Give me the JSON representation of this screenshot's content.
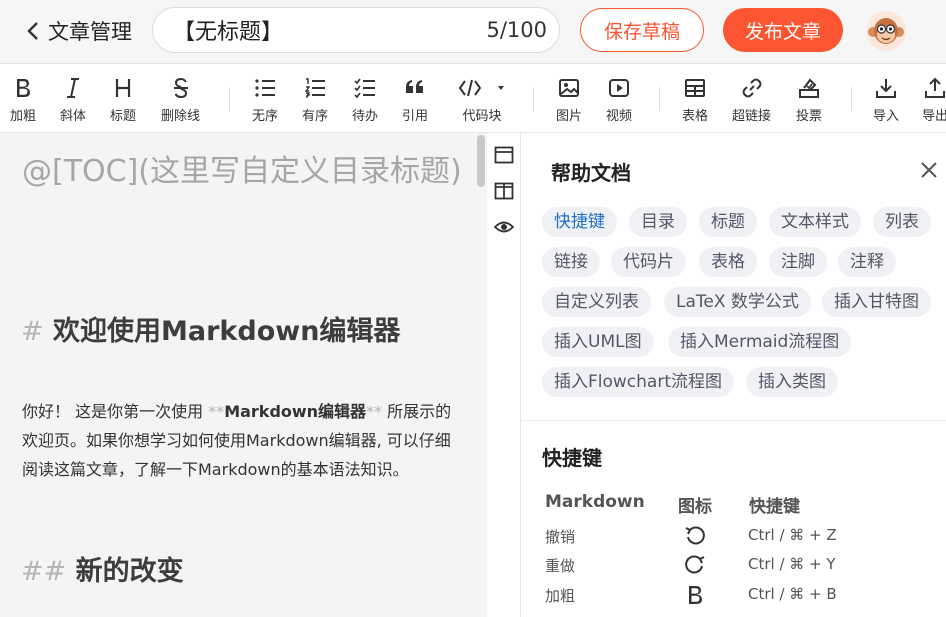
{
  "header": {
    "back_label": "文章管理",
    "title_value": "【无标题】",
    "title_count": "5/100",
    "save_draft_label": "保存草稿",
    "publish_label": "发布文章"
  },
  "toolbar": {
    "items": [
      {
        "label": "加粗",
        "icon": "bold-icon"
      },
      {
        "label": "斜体",
        "icon": "italic-icon"
      },
      {
        "label": "标题",
        "icon": "heading-icon"
      },
      {
        "label": "删除线",
        "icon": "strikethrough-icon"
      },
      {
        "label": "无序",
        "icon": "unordered-list-icon"
      },
      {
        "label": "有序",
        "icon": "ordered-list-icon"
      },
      {
        "label": "待办",
        "icon": "todo-list-icon"
      },
      {
        "label": "引用",
        "icon": "quote-icon"
      },
      {
        "label": "代码块",
        "icon": "code-block-icon"
      },
      {
        "label": "图片",
        "icon": "image-icon"
      },
      {
        "label": "视频",
        "icon": "video-icon"
      },
      {
        "label": "表格",
        "icon": "table-icon"
      },
      {
        "label": "超链接",
        "icon": "link-icon"
      },
      {
        "label": "投票",
        "icon": "vote-icon"
      },
      {
        "label": "导入",
        "icon": "import-icon"
      },
      {
        "label": "导出",
        "icon": "export-icon"
      }
    ]
  },
  "editor": {
    "toc_line": "@[TOC](这里写自定义目录标题)",
    "h1_mark": "#",
    "h1_text": "欢迎使用Markdown编辑器",
    "para_1": "你好！ 这是你第一次使用 ",
    "para_bold_mark_open": "**",
    "para_bold": "Markdown编辑器",
    "para_bold_mark_close": "**",
    "para_2": " 所展示的欢迎页。如果你想学习如何使用Markdown编辑器, 可以仔细阅读这篇文章，了解一下Markdown的基本语法知识。",
    "h2_mark": "##",
    "h2_text": "新的改变"
  },
  "help": {
    "title": "帮助文档",
    "tags": [
      "快捷键",
      "目录",
      "标题",
      "文本样式",
      "列表",
      "链接",
      "代码片",
      "表格",
      "注脚",
      "注释",
      "自定义列表",
      "LaTeX 数学公式",
      "插入甘特图",
      "插入UML图",
      "插入Mermaid流程图",
      "插入Flowchart流程图",
      "插入类图"
    ],
    "active_tag": "快捷键",
    "shortcuts_title": "快捷键",
    "columns": [
      "Markdown",
      "图标",
      "快捷键"
    ],
    "rows": [
      {
        "name": "撤销",
        "icon": "undo-icon",
        "keys": "Ctrl / ⌘ + Z"
      },
      {
        "name": "重做",
        "icon": "redo-icon",
        "keys": "Ctrl / ⌘ + Y"
      },
      {
        "name": "加粗",
        "icon": "bold-icon",
        "keys": "Ctrl / ⌘ + B"
      }
    ]
  },
  "colors": {
    "accent": "#fc5531",
    "tag_active": "#1e71c4",
    "tag_bg": "#f0f1f5",
    "editor_bg": "#f4f4f4"
  }
}
